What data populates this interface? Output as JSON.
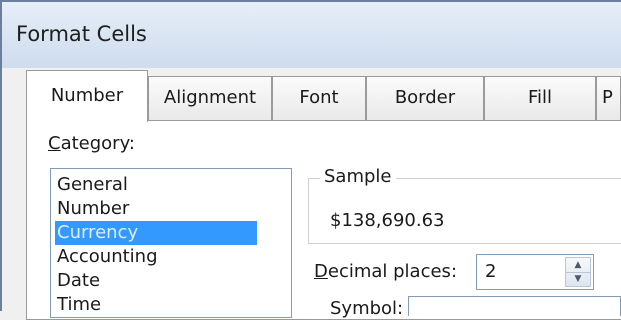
{
  "window": {
    "title": "Format Cells"
  },
  "tabs": [
    {
      "label": "Number",
      "active": true
    },
    {
      "label": "Alignment"
    },
    {
      "label": "Font"
    },
    {
      "label": "Border"
    },
    {
      "label": "Fill"
    },
    {
      "label": "P"
    }
  ],
  "category": {
    "label_accel": "C",
    "label_rest": "ategory:",
    "items": [
      "General",
      "Number",
      "Currency",
      "Accounting",
      "Date",
      "Time"
    ],
    "selected": "Currency"
  },
  "sample": {
    "legend": "Sample",
    "value": "$138,690.63"
  },
  "decimal_places": {
    "label_accel": "D",
    "label_rest": "ecimal places:",
    "value": "2"
  },
  "symbol": {
    "label": "Symbol:"
  },
  "colors": {
    "selection": "#3399ff",
    "title_bar": "#dbe6f3",
    "dialog_bg": "#f0f0f0"
  }
}
